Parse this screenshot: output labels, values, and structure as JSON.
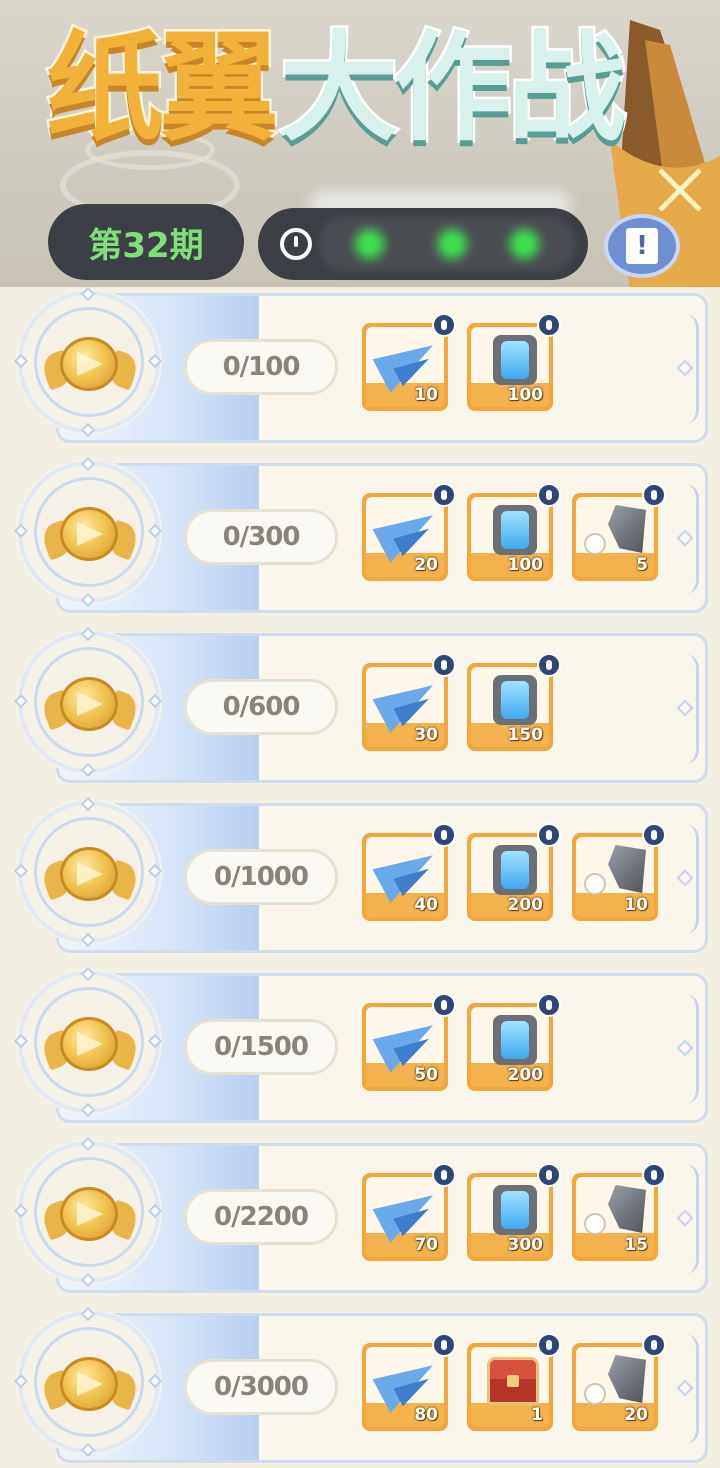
{
  "header": {
    "title_part1": "纸翼",
    "title_part2": "大作战",
    "period": "第32期",
    "info_icon": "book-exclamation-icon"
  },
  "colors": {
    "title_orange": "#f2b23a",
    "title_mint": "#d9f1ec",
    "period_green": "#7fe07b",
    "reward_frame": "#f3a63a",
    "lock_badge": "#2f4775"
  },
  "tiers": [
    {
      "progress": "0/100",
      "rewards": [
        {
          "icon": "paper-plane-icon",
          "count": "10"
        },
        {
          "icon": "energy-gear-icon",
          "count": "100"
        }
      ]
    },
    {
      "progress": "0/300",
      "rewards": [
        {
          "icon": "paper-plane-icon",
          "count": "20"
        },
        {
          "icon": "energy-gear-icon",
          "count": "100"
        },
        {
          "icon": "ore-stone-icon",
          "count": "5"
        }
      ]
    },
    {
      "progress": "0/600",
      "rewards": [
        {
          "icon": "paper-plane-icon",
          "count": "30"
        },
        {
          "icon": "energy-gear-icon",
          "count": "150"
        }
      ]
    },
    {
      "progress": "0/1000",
      "rewards": [
        {
          "icon": "paper-plane-icon",
          "count": "40"
        },
        {
          "icon": "energy-gear-icon",
          "count": "200"
        },
        {
          "icon": "ore-stone-icon",
          "count": "10"
        }
      ]
    },
    {
      "progress": "0/1500",
      "rewards": [
        {
          "icon": "paper-plane-icon",
          "count": "50"
        },
        {
          "icon": "energy-gear-icon",
          "count": "200"
        }
      ]
    },
    {
      "progress": "0/2200",
      "rewards": [
        {
          "icon": "paper-plane-icon",
          "count": "70"
        },
        {
          "icon": "energy-gear-icon",
          "count": "300"
        },
        {
          "icon": "ore-stone-icon",
          "count": "15"
        }
      ]
    },
    {
      "progress": "0/3000",
      "rewards": [
        {
          "icon": "paper-plane-icon",
          "count": "80"
        },
        {
          "icon": "treasure-chest-icon",
          "count": "1"
        },
        {
          "icon": "ore-stone-icon",
          "count": "20"
        }
      ]
    }
  ]
}
